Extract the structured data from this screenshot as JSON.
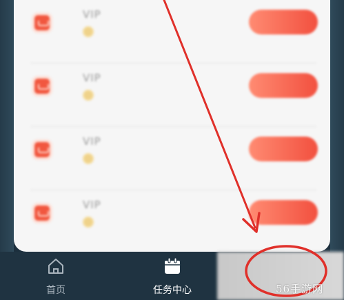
{
  "tasks": [
    {
      "title": "VIP",
      "reward": "",
      "button": ""
    },
    {
      "title": "VIP",
      "reward": "",
      "button": ""
    },
    {
      "title": "VIP",
      "reward": "",
      "button": ""
    },
    {
      "title": "VIP",
      "reward": "",
      "button": ""
    }
  ],
  "tabbar": {
    "home_label": "首页",
    "tasks_label": "任务中心"
  },
  "watermark": "56手游网",
  "colors": {
    "accent": "#f2503f",
    "annotation": "#e0302a",
    "tabbar_bg": "#1f3341"
  }
}
